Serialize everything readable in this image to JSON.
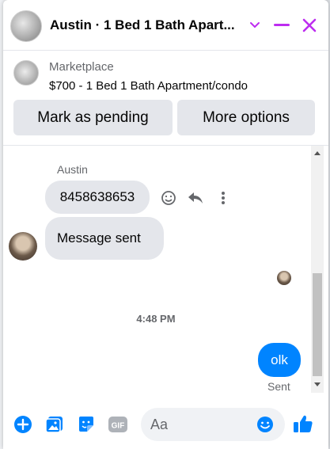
{
  "header": {
    "title": "Austin · 1 Bed 1 Bath Apart...",
    "accent": "#bd2cf0"
  },
  "listing": {
    "source": "Marketplace",
    "item": "$700 - 1 Bed 1 Bath Apartment/condo",
    "mark_pending_label": "Mark as pending",
    "more_options_label": "More options"
  },
  "messages": {
    "sender": "Austin",
    "msg1": "8458638653",
    "msg2": "Message sent",
    "time": "4:48 PM",
    "own_msg": "olk",
    "status": "Sent"
  },
  "composer": {
    "placeholder": "Aa",
    "accent": "#0084ff"
  },
  "icons": [
    "chevron-down-icon",
    "minimize-icon",
    "close-icon",
    "emoji-icon",
    "reply-icon",
    "more-icon",
    "plus-icon",
    "image-icon",
    "sticker-icon",
    "gif-icon",
    "like-icon"
  ]
}
